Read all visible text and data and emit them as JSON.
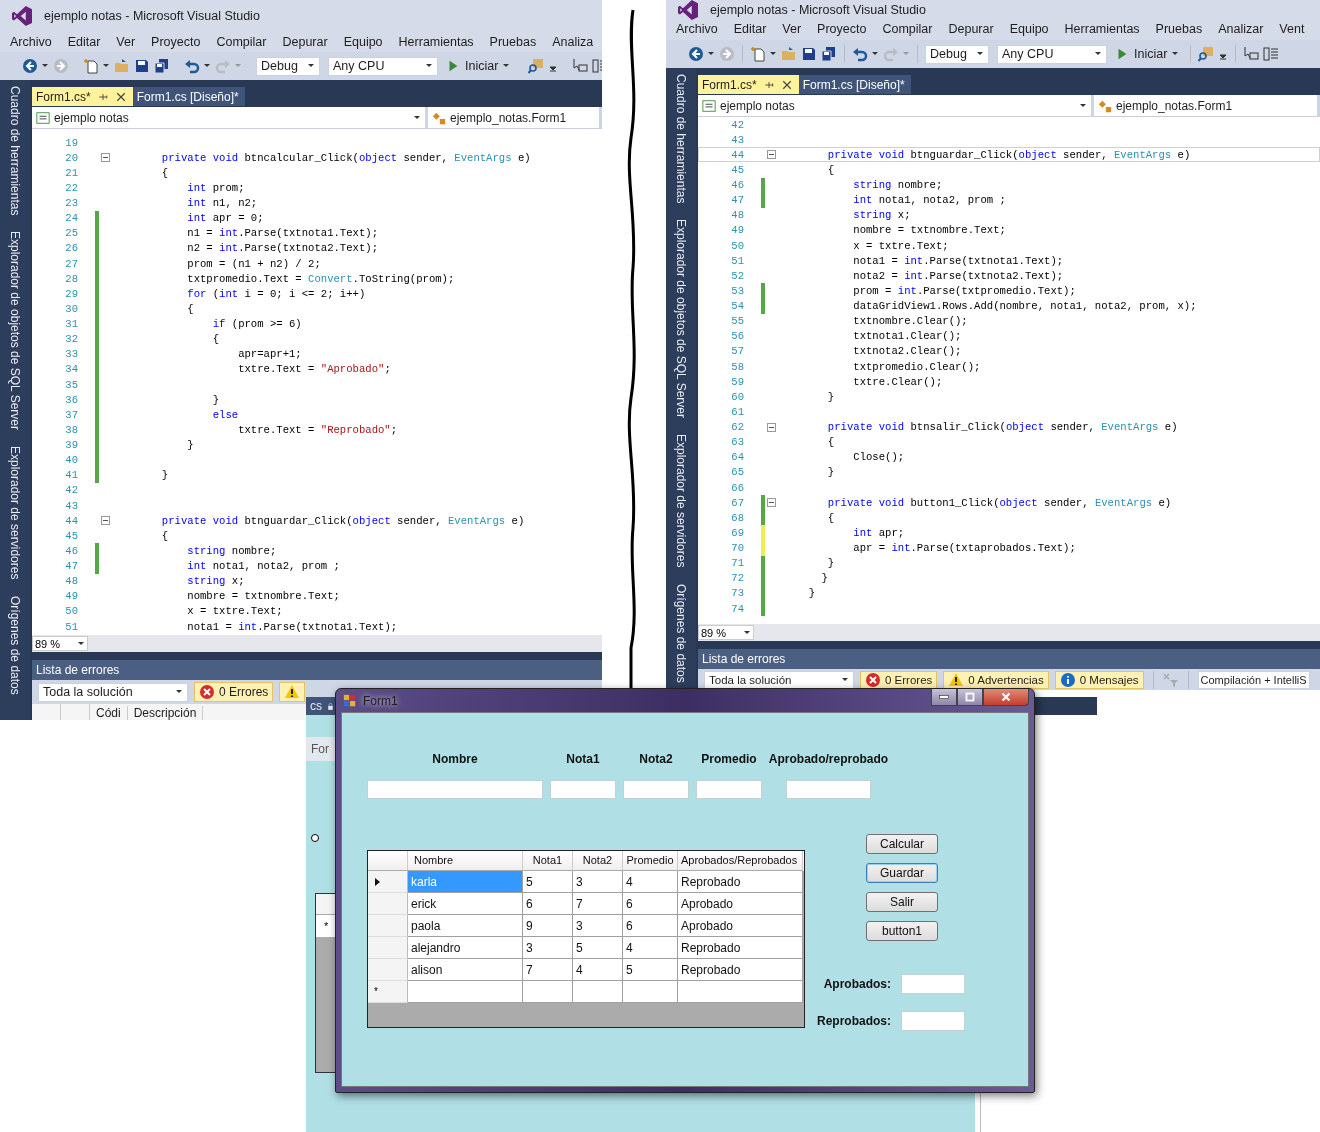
{
  "windows": [
    {
      "title": "ejemplo notas - Microsoft Visual Studio",
      "menu": [
        "Archivo",
        "Editar",
        "Ver",
        "Proyecto",
        "Compilar",
        "Depurar",
        "Equipo",
        "Herramientas",
        "Pruebas",
        "Analiza"
      ],
      "toolbar": {
        "configuration": "Debug",
        "platform": "Any CPU",
        "start": "Iniciar"
      },
      "side_tabs": [
        "Cuadro de herramientas",
        "Explorador de objetos de SQL Server",
        "Explorador de servidores",
        "Orígenes de datos"
      ],
      "tabs": [
        {
          "label": "Form1.cs*",
          "selected": true
        },
        {
          "label": "Form1.cs [Diseño]*",
          "selected": false
        }
      ],
      "nav": {
        "project": "ejemplo notas",
        "member": "ejemplo_notas.Form1"
      },
      "code": [
        {
          "n": "19"
        },
        {
          "n": "20",
          "fold": true,
          "parts": [
            {
              "kind": "kw",
              "text": "        private void"
            },
            {
              "kind": "p",
              "text": " btncalcular_Click("
            },
            {
              "kind": "kw",
              "text": "object"
            },
            {
              "kind": "p",
              "text": " sender, "
            },
            {
              "kind": "ty",
              "text": "EventArgs"
            },
            {
              "kind": "p",
              "text": " e)"
            }
          ]
        },
        {
          "n": "21",
          "parts": [
            {
              "kind": "p",
              "text": "        {"
            }
          ]
        },
        {
          "n": "22",
          "parts": [
            {
              "kind": "kw",
              "text": "            int"
            },
            {
              "kind": "p",
              "text": " prom;"
            }
          ]
        },
        {
          "n": "23",
          "parts": [
            {
              "kind": "kw",
              "text": "            int"
            },
            {
              "kind": "p",
              "text": " n1, n2;"
            }
          ]
        },
        {
          "n": "24",
          "modified": true,
          "saved": true,
          "parts": [
            {
              "kind": "kw",
              "text": "            int"
            },
            {
              "kind": "p",
              "text": " apr = 0;"
            }
          ]
        },
        {
          "n": "25",
          "modified": true,
          "saved": true,
          "parts": [
            {
              "kind": "p",
              "text": "            n1 = "
            },
            {
              "kind": "kw",
              "text": "int"
            },
            {
              "kind": "p",
              "text": ".Parse(txtnota1.Text);"
            }
          ]
        },
        {
          "n": "26",
          "modified": true,
          "saved": true,
          "parts": [
            {
              "kind": "p",
              "text": "            n2 = "
            },
            {
              "kind": "kw",
              "text": "int"
            },
            {
              "kind": "p",
              "text": ".Parse(txtnota2.Text);"
            }
          ]
        },
        {
          "n": "27",
          "modified": true,
          "saved": true,
          "parts": [
            {
              "kind": "p",
              "text": "            prom = (n1 + n2) / 2;"
            }
          ]
        },
        {
          "n": "28",
          "modified": true,
          "saved": true,
          "parts": [
            {
              "kind": "p",
              "text": "            txtpromedio.Text = "
            },
            {
              "kind": "ty",
              "text": "Convert"
            },
            {
              "kind": "p",
              "text": ".ToString(prom);"
            }
          ]
        },
        {
          "n": "29",
          "modified": true,
          "saved": true,
          "parts": [
            {
              "kind": "kw",
              "text": "            for"
            },
            {
              "kind": "p",
              "text": " ("
            },
            {
              "kind": "kw",
              "text": "int"
            },
            {
              "kind": "p",
              "text": " i = 0; i <= 2; i++)"
            }
          ]
        },
        {
          "n": "30",
          "modified": true,
          "saved": true,
          "parts": [
            {
              "kind": "p",
              "text": "            {"
            }
          ]
        },
        {
          "n": "31",
          "modified": true,
          "saved": true,
          "parts": [
            {
              "kind": "kw",
              "text": "                if"
            },
            {
              "kind": "p",
              "text": " (prom >= 6)"
            }
          ]
        },
        {
          "n": "32",
          "modified": true,
          "saved": true,
          "parts": [
            {
              "kind": "p",
              "text": "                {"
            }
          ]
        },
        {
          "n": "33",
          "modified": true,
          "saved": true,
          "parts": [
            {
              "kind": "p",
              "text": "                    apr=apr+1;"
            }
          ]
        },
        {
          "n": "34",
          "modified": true,
          "saved": true,
          "parts": [
            {
              "kind": "p",
              "text": "                    txtre.Text = "
            },
            {
              "kind": "str",
              "text": "\"Aprobado\""
            },
            {
              "kind": "p",
              "text": ";"
            }
          ]
        },
        {
          "n": "35",
          "modified": true,
          "saved": true
        },
        {
          "n": "36",
          "modified": true,
          "saved": true,
          "parts": [
            {
              "kind": "p",
              "text": "                }"
            }
          ]
        },
        {
          "n": "37",
          "modified": true,
          "saved": true,
          "parts": [
            {
              "kind": "kw",
              "text": "                else"
            }
          ]
        },
        {
          "n": "38",
          "modified": true,
          "saved": true,
          "parts": [
            {
              "kind": "p",
              "text": "                    txtre.Text = "
            },
            {
              "kind": "str",
              "text": "\"Reprobado\""
            },
            {
              "kind": "p",
              "text": ";"
            }
          ]
        },
        {
          "n": "39",
          "modified": true,
          "saved": true,
          "parts": [
            {
              "kind": "p",
              "text": "            }"
            }
          ]
        },
        {
          "n": "40",
          "modified": true,
          "saved": true
        },
        {
          "n": "41",
          "modified": true,
          "saved": true,
          "parts": [
            {
              "kind": "p",
              "text": "        }"
            }
          ]
        },
        {
          "n": "42"
        },
        {
          "n": "43"
        },
        {
          "n": "44",
          "fold": true,
          "parts": [
            {
              "kind": "kw",
              "text": "        private void"
            },
            {
              "kind": "p",
              "text": " btnguardar_Click("
            },
            {
              "kind": "kw",
              "text": "object"
            },
            {
              "kind": "p",
              "text": " sender, "
            },
            {
              "kind": "ty",
              "text": "EventArgs"
            },
            {
              "kind": "p",
              "text": " e)"
            }
          ]
        },
        {
          "n": "45",
          "parts": [
            {
              "kind": "p",
              "text": "        {"
            }
          ]
        },
        {
          "n": "46",
          "modified": true,
          "saved": true,
          "parts": [
            {
              "kind": "kw",
              "text": "            string"
            },
            {
              "kind": "p",
              "text": " nombre;"
            }
          ]
        },
        {
          "n": "47",
          "modified": true,
          "saved": true,
          "parts": [
            {
              "kind": "kw",
              "text": "            int"
            },
            {
              "kind": "p",
              "text": " nota1, nota2, prom ;"
            }
          ]
        },
        {
          "n": "48",
          "parts": [
            {
              "kind": "kw",
              "text": "            string"
            },
            {
              "kind": "p",
              "text": " x;"
            }
          ]
        },
        {
          "n": "49",
          "parts": [
            {
              "kind": "p",
              "text": "            nombre = txtnombre.Text;"
            }
          ]
        },
        {
          "n": "50",
          "parts": [
            {
              "kind": "p",
              "text": "            x = txtre.Text;"
            }
          ]
        },
        {
          "n": "51",
          "parts": [
            {
              "kind": "p",
              "text": "            nota1 = "
            },
            {
              "kind": "kw",
              "text": "int"
            },
            {
              "kind": "p",
              "text": ".Parse(txtnota1.Text);"
            }
          ]
        }
      ],
      "zoom": "89 %",
      "error_list": {
        "title": "Lista de errores",
        "scope": "Toda la solución",
        "filters": [
          {
            "kind": "error",
            "label": "0 Errores"
          },
          {
            "kind": "warning"
          }
        ],
        "columns": [
          "Códi",
          "Descripción"
        ]
      }
    },
    {
      "title": "ejemplo notas - Microsoft Visual Studio",
      "menu": [
        "Archivo",
        "Editar",
        "Ver",
        "Proyecto",
        "Compilar",
        "Depurar",
        "Equipo",
        "Herramientas",
        "Pruebas",
        "Analizar",
        "Vent"
      ],
      "toolbar": {
        "configuration": "Debug",
        "platform": "Any CPU",
        "start": "Iniciar"
      },
      "side_tabs": [
        "Cuadro de herramientas",
        "Explorador de objetos de SQL Server",
        "Explorador de servidores",
        "Orígenes de datos"
      ],
      "tabs": [
        {
          "label": "Form1.cs*",
          "selected": true
        },
        {
          "label": "Form1.cs [Diseño]*",
          "selected": false
        }
      ],
      "nav": {
        "project": "ejemplo notas",
        "member": "ejemplo_notas.Form1"
      },
      "code": [
        {
          "n": "42"
        },
        {
          "n": "43"
        },
        {
          "n": "44",
          "fold": true,
          "current": true,
          "parts": [
            {
              "kind": "kw",
              "text": "        private void"
            },
            {
              "kind": "p",
              "text": " btnguardar_Click("
            },
            {
              "kind": "kw",
              "text": "object"
            },
            {
              "kind": "p",
              "text": " sender, "
            },
            {
              "kind": "ty",
              "text": "EventArgs"
            },
            {
              "kind": "p",
              "text": " e)"
            }
          ]
        },
        {
          "n": "45",
          "parts": [
            {
              "kind": "p",
              "text": "        {"
            }
          ]
        },
        {
          "n": "46",
          "modified": true,
          "saved": true,
          "parts": [
            {
              "kind": "kw",
              "text": "            string"
            },
            {
              "kind": "p",
              "text": " nombre;"
            }
          ]
        },
        {
          "n": "47",
          "modified": true,
          "saved": true,
          "parts": [
            {
              "kind": "kw",
              "text": "            int"
            },
            {
              "kind": "p",
              "text": " nota1, nota2, prom ;"
            }
          ]
        },
        {
          "n": "48",
          "parts": [
            {
              "kind": "kw",
              "text": "            string"
            },
            {
              "kind": "p",
              "text": " x;"
            }
          ]
        },
        {
          "n": "49",
          "parts": [
            {
              "kind": "p",
              "text": "            nombre = txtnombre.Text;"
            }
          ]
        },
        {
          "n": "50",
          "parts": [
            {
              "kind": "p",
              "text": "            x = txtre.Text;"
            }
          ]
        },
        {
          "n": "51",
          "parts": [
            {
              "kind": "p",
              "text": "            nota1 = "
            },
            {
              "kind": "kw",
              "text": "int"
            },
            {
              "kind": "p",
              "text": ".Parse(txtnota1.Text);"
            }
          ]
        },
        {
          "n": "52",
          "parts": [
            {
              "kind": "p",
              "text": "            nota2 = "
            },
            {
              "kind": "kw",
              "text": "int"
            },
            {
              "kind": "p",
              "text": ".Parse(txtnota2.Text);"
            }
          ]
        },
        {
          "n": "53",
          "modified": true,
          "saved": true,
          "parts": [
            {
              "kind": "p",
              "text": "            prom = "
            },
            {
              "kind": "kw",
              "text": "int"
            },
            {
              "kind": "p",
              "text": ".Parse(txtpromedio.Text);"
            }
          ]
        },
        {
          "n": "54",
          "modified": true,
          "saved": true,
          "parts": [
            {
              "kind": "p",
              "text": "            dataGridView1.Rows.Add(nombre, nota1, nota2, prom, x);"
            }
          ]
        },
        {
          "n": "55",
          "parts": [
            {
              "kind": "p",
              "text": "            txtnombre.Clear();"
            }
          ]
        },
        {
          "n": "56",
          "parts": [
            {
              "kind": "p",
              "text": "            txtnota1.Clear();"
            }
          ]
        },
        {
          "n": "57",
          "parts": [
            {
              "kind": "p",
              "text": "            txtnota2.Clear();"
            }
          ]
        },
        {
          "n": "58",
          "parts": [
            {
              "kind": "p",
              "text": "            txtpromedio.Clear();"
            }
          ]
        },
        {
          "n": "59",
          "parts": [
            {
              "kind": "p",
              "text": "            txtre.Clear();"
            }
          ]
        },
        {
          "n": "60",
          "parts": [
            {
              "kind": "p",
              "text": "        }"
            }
          ]
        },
        {
          "n": "61"
        },
        {
          "n": "62",
          "fold": true,
          "parts": [
            {
              "kind": "kw",
              "text": "        private void"
            },
            {
              "kind": "p",
              "text": " btnsalir_Click("
            },
            {
              "kind": "kw",
              "text": "object"
            },
            {
              "kind": "p",
              "text": " sender, "
            },
            {
              "kind": "ty",
              "text": "EventArgs"
            },
            {
              "kind": "p",
              "text": " e)"
            }
          ]
        },
        {
          "n": "63",
          "parts": [
            {
              "kind": "p",
              "text": "        {"
            }
          ]
        },
        {
          "n": "64",
          "parts": [
            {
              "kind": "p",
              "text": "            Close();"
            }
          ]
        },
        {
          "n": "65",
          "parts": [
            {
              "kind": "p",
              "text": "        }"
            }
          ]
        },
        {
          "n": "66"
        },
        {
          "n": "67",
          "fold": true,
          "modified": true,
          "saved": true,
          "parts": [
            {
              "kind": "kw",
              "text": "        private void"
            },
            {
              "kind": "p",
              "text": " button1_Click("
            },
            {
              "kind": "kw",
              "text": "object"
            },
            {
              "kind": "p",
              "text": " sender, "
            },
            {
              "kind": "ty",
              "text": "EventArgs"
            },
            {
              "kind": "p",
              "text": " e)"
            }
          ]
        },
        {
          "n": "68",
          "modified": true,
          "saved": true,
          "parts": [
            {
              "kind": "p",
              "text": "        {"
            }
          ]
        },
        {
          "n": "69",
          "modified": true,
          "saved": false,
          "parts": [
            {
              "kind": "kw",
              "text": "            int"
            },
            {
              "kind": "p",
              "text": " apr;"
            }
          ]
        },
        {
          "n": "70",
          "modified": true,
          "saved": false,
          "parts": [
            {
              "kind": "p",
              "text": "            apr = "
            },
            {
              "kind": "kw",
              "text": "int"
            },
            {
              "kind": "p",
              "text": ".Parse(txtaprobados.Text);"
            }
          ]
        },
        {
          "n": "71",
          "modified": true,
          "saved": true,
          "parts": [
            {
              "kind": "p",
              "text": "        }"
            }
          ]
        },
        {
          "n": "72",
          "modified": true,
          "saved": true,
          "parts": [
            {
              "kind": "p",
              "text": "       }"
            }
          ]
        },
        {
          "n": "73",
          "modified": true,
          "saved": true,
          "parts": [
            {
              "kind": "p",
              "text": "     }"
            }
          ]
        },
        {
          "n": "74",
          "modified": true,
          "saved": true
        }
      ],
      "zoom": "89 %",
      "error_list": {
        "title": "Lista de errores",
        "scope": "Toda la solución",
        "filters": [
          {
            "kind": "error",
            "label": "0 Errores"
          },
          {
            "kind": "warning",
            "label": "0 Advertencias"
          },
          {
            "kind": "info",
            "label": "0 Mensajes"
          }
        ],
        "source": "Compilación + IntelliS"
      }
    }
  ],
  "designer": {
    "tab": "cs",
    "caption": "For",
    "new_row_marker": "*"
  },
  "form": {
    "title": "Form1",
    "fields": [
      {
        "label": "Nombre"
      },
      {
        "label": "Nota1"
      },
      {
        "label": "Nota2"
      },
      {
        "label": "Promedio"
      },
      {
        "label": "Aprobado/reprobado"
      }
    ],
    "grid": {
      "columns": [
        "Nombre",
        "Nota1",
        "Nota2",
        "Promedio",
        "Aprobados/Reprobados"
      ],
      "rows": [
        {
          "cells": [
            "karla",
            "5",
            "3",
            "4",
            "Reprobado"
          ],
          "selected": true
        },
        {
          "cells": [
            "erick",
            "6",
            "7",
            "6",
            "Aprobado"
          ],
          "selected": false
        },
        {
          "cells": [
            "paola",
            "9",
            "3",
            "6",
            "Aprobado"
          ],
          "selected": false
        },
        {
          "cells": [
            "alejandro",
            "3",
            "5",
            "4",
            "Reprobado"
          ],
          "selected": false
        },
        {
          "cells": [
            "alison",
            "7",
            "4",
            "5",
            "Reprobado"
          ],
          "selected": false
        }
      ],
      "new_row_marker": "*"
    },
    "buttons": [
      {
        "label": "Calcular",
        "focused": false
      },
      {
        "label": "Guardar",
        "focused": true
      },
      {
        "label": "Salir",
        "focused": false
      },
      {
        "label": "button1",
        "focused": false
      }
    ],
    "totals": [
      {
        "label": "Aprobados:"
      },
      {
        "label": "Reprobados:"
      }
    ]
  }
}
